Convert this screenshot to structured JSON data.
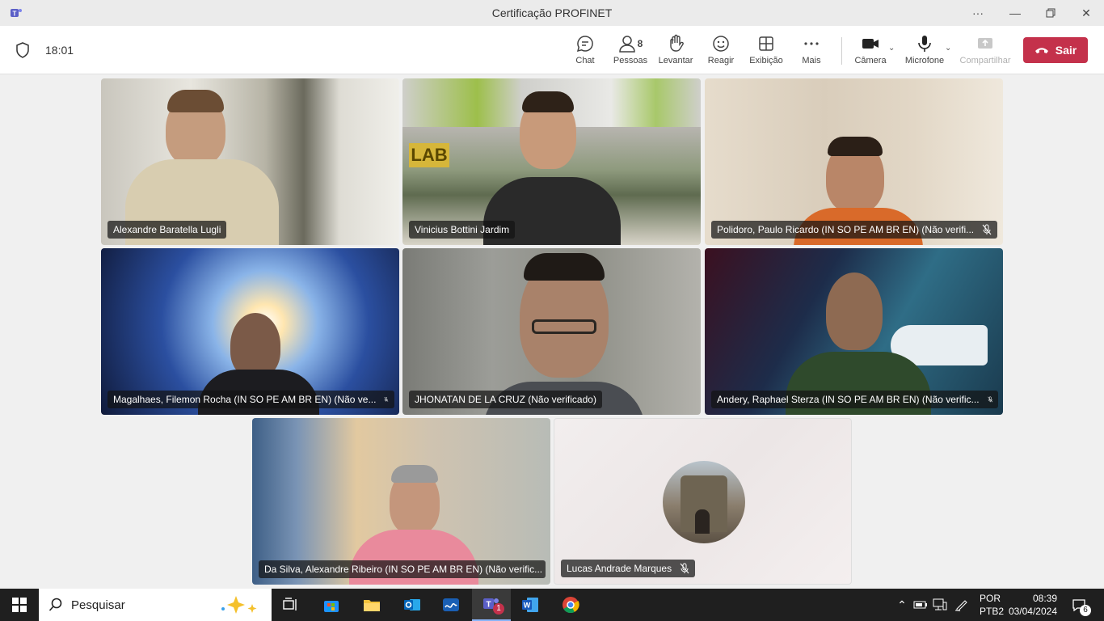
{
  "window": {
    "title": "Certificação PROFINET"
  },
  "meeting": {
    "timer": "18:01"
  },
  "toolbar": {
    "chat": "Chat",
    "people": "Pessoas",
    "people_count": "8",
    "raise": "Levantar",
    "react": "Reagir",
    "view": "Exibição",
    "more": "Mais",
    "camera": "Câmera",
    "mic": "Microfone",
    "share": "Compartilhar",
    "leave": "Sair"
  },
  "participants": [
    {
      "name": "Alexandre Baratella Lugli",
      "muted": false
    },
    {
      "name": "Vinicius Bottini Jardim",
      "muted": false
    },
    {
      "name": "Polidoro, Paulo Ricardo (IN SO PE AM BR EN) (Não verifi...",
      "muted": true
    },
    {
      "name": "Magalhaes, Filemon Rocha (IN SO PE AM BR EN) (Não ve...",
      "muted": true
    },
    {
      "name": "JHONATAN DE LA CRUZ (Não verificado)",
      "muted": false
    },
    {
      "name": "Andery, Raphael Sterza (IN SO PE AM BR EN) (Não verific...",
      "muted": true
    },
    {
      "name": "Da Silva, Alexandre Ribeiro (IN SO PE AM BR EN) (Não verific...",
      "muted": false
    },
    {
      "name": "Lucas Andrade Marques",
      "muted": true
    }
  ],
  "taskbar": {
    "search": "Pesquisar",
    "teams_badge": "1",
    "lang_line1": "POR",
    "lang_line2": "PTB2",
    "time": "08:39",
    "date": "03/04/2024",
    "notifications": "6"
  },
  "colors": {
    "leave": "#c4314b",
    "taskbar": "#1f1f1f",
    "teams": "#5b5fc7"
  }
}
